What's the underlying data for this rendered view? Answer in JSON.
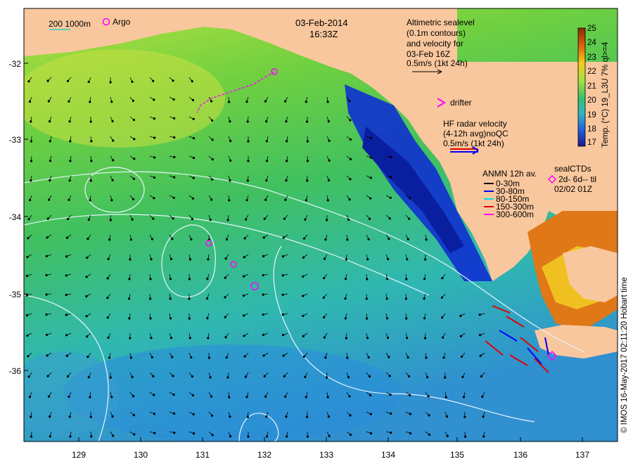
{
  "map": {
    "date": "03-Feb-2014",
    "time": "16:33Z",
    "argo_label": "Argo",
    "scale_label": "200  1000m",
    "sealevel_lines": [
      "Altimetric sealevel",
      "(0.1m contours)",
      "and velocity for",
      "03-Feb 16Z",
      "0.5m/s (1kt 24h)"
    ],
    "drifter_label": "drifter",
    "hfradar_lines": [
      "HF radar velocity",
      "(4-12h avg)noQC",
      "0.5m/s (1kt 24h)"
    ],
    "anmn_title": "ANMN 12h av.",
    "anmn_legend": [
      {
        "label": "0-30m",
        "color": "#000000"
      },
      {
        "label": "30-80m",
        "color": "#0000ff"
      },
      {
        "label": "80-150m",
        "color": "#00e0e0"
      },
      {
        "label": "150-300m",
        "color": "#e00000"
      },
      {
        "label": "300-600m",
        "color": "#ff00ff"
      }
    ],
    "sealctd_lines": [
      "sealCTDs",
      "2d- 6d-- til",
      "02/02 01Z"
    ],
    "y_ticks": [
      "-32",
      "-33",
      "-34",
      "-35",
      "-36"
    ],
    "y_values": [
      -32,
      -33,
      -34,
      -35,
      -36
    ],
    "x_ticks": [
      "129",
      "130",
      "131",
      "132",
      "133",
      "134",
      "135",
      "136",
      "137"
    ],
    "x_values": [
      129,
      130,
      131,
      132,
      133,
      134,
      135,
      136,
      137
    ],
    "colorbar_ticks": [
      "25",
      "24",
      "23",
      "22",
      "21",
      "20",
      "19",
      "18",
      "17"
    ],
    "colorbar_label": "Temp. (°C) 19_L3U 7% ql>=4",
    "credit": "© IMOS 16-May-2017 02:11:20 Hobart time",
    "colors": {
      "land": "#f9c79d",
      "coastal_cold": "#1030d0",
      "drifter": "#ff00ff"
    }
  }
}
